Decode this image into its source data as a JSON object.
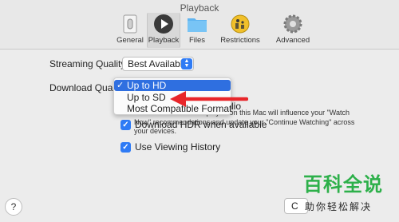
{
  "window": {
    "title": "Playback"
  },
  "toolbar": {
    "items": [
      {
        "label": "General",
        "icon": "switch-icon"
      },
      {
        "label": "Playback",
        "icon": "play-icon"
      },
      {
        "label": "Files",
        "icon": "folder-icon"
      },
      {
        "label": "Restrictions",
        "icon": "parental-controls-icon"
      },
      {
        "label": "Advanced",
        "icon": "gear-icon"
      }
    ],
    "selected": "Playback"
  },
  "streaming": {
    "label": "Streaming Quality:",
    "value": "Best Available"
  },
  "download": {
    "label": "Download Quality",
    "menu": [
      {
        "label": "Up to HD",
        "checked": true
      },
      {
        "label": "Up to SD",
        "checked": false
      },
      {
        "label": "Most Compatible Format",
        "checked": false
      }
    ]
  },
  "options": {
    "partial_text": "dio",
    "hdr": "Download HDR when available",
    "history": "Use Viewing History",
    "history_desc": "TV shows and movies played on this Mac will influence your \"Watch Now\" recommendations and update your \"Continue Watching\" across your devices."
  },
  "footer": {
    "help": "?",
    "cancel_partial": "C"
  },
  "watermark": {
    "title": "百科全说",
    "subtitle": "助你轻松解决"
  },
  "colors": {
    "accent": "#2f7bf5",
    "menu_highlight": "#2f6fe0",
    "arrow": "#e8262a",
    "watermark_green": "#2db04a"
  }
}
